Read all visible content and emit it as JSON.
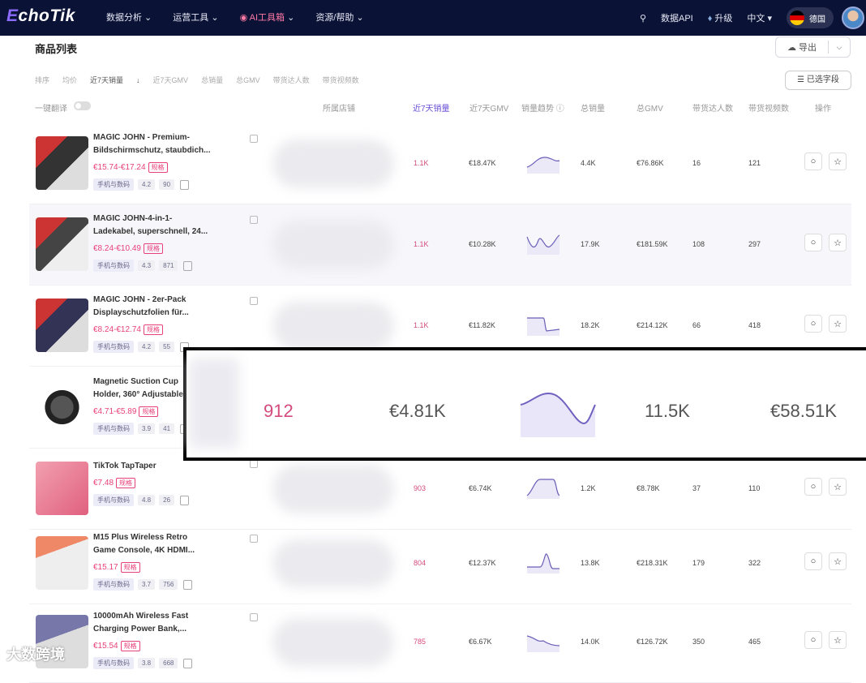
{
  "nav": {
    "logo": "EchoTik",
    "links": [
      "数据分析",
      "运营工具",
      "AI工具箱",
      "资源/帮助"
    ],
    "api": "数据API",
    "upgrade": "升级",
    "lang": "中文",
    "country": "德国"
  },
  "page": {
    "title": "商品列表",
    "export": "导出",
    "fields": "已选字段",
    "translate": "一键翻译"
  },
  "sort": {
    "label": "排序",
    "options": [
      "均价",
      "近7天销量",
      "近7天GMV",
      "总销量",
      "总GMV",
      "带货达人数",
      "带货视频数"
    ]
  },
  "columns": [
    "所属店铺",
    "近7天销量",
    "近7天GMV",
    "销量趋势",
    "总销量",
    "总GMV",
    "带货达人数",
    "带货视频数",
    "操作"
  ],
  "rows": [
    {
      "name1": "MAGIC JOHN - Premium-",
      "name2": "Bildschirmschutz, staubdich...",
      "price": "€15.74-€17.24",
      "spec": "规格",
      "cat": "手机与数码",
      "rating": "4.2",
      "reviews": "90",
      "sales7": "1.1K",
      "gmv7": "€18.47K",
      "total": "4.4K",
      "gmv": "€76.86K",
      "creators": "16",
      "videos": "121"
    },
    {
      "name1": "MAGIC JOHN-4-in-1-",
      "name2": "Ladekabel, superschnell, 24...",
      "price": "€8.24-€10.49",
      "spec": "规格",
      "cat": "手机与数码",
      "rating": "4.3",
      "reviews": "871",
      "sales7": "1.1K",
      "gmv7": "€10.28K",
      "total": "17.9K",
      "gmv": "€181.59K",
      "creators": "108",
      "videos": "297"
    },
    {
      "name1": "MAGIC JOHN - 2er-Pack",
      "name2": "Displayschutzfolien für...",
      "price": "€8.24-€12.74",
      "spec": "规格",
      "cat": "手机与数码",
      "rating": "4.2",
      "reviews": "55",
      "sales7": "1.1K",
      "gmv7": "€11.82K",
      "total": "18.2K",
      "gmv": "€214.12K",
      "creators": "66",
      "videos": "418"
    },
    {
      "name1": "Magnetic Suction Cup",
      "name2": "Holder, 360° Adjustable",
      "price": "€4.71-€5.89",
      "spec": "规格",
      "cat": "手机与数码",
      "rating": "3.9",
      "reviews": "41",
      "sales7": "",
      "gmv7": "",
      "total": "",
      "gmv": "",
      "creators": "",
      "videos": ""
    },
    {
      "name1": "TikTok TapTaper",
      "name2": "",
      "price": "€7.48",
      "spec": "规格",
      "cat": "手机与数码",
      "rating": "4.8",
      "reviews": "26",
      "sales7": "903",
      "gmv7": "€6.74K",
      "total": "1.2K",
      "gmv": "€8.78K",
      "creators": "37",
      "videos": "110"
    },
    {
      "name1": "M15 Plus Wireless Retro",
      "name2": "Game Console, 4K HDMI...",
      "price": "€15.17",
      "spec": "规格",
      "cat": "手机与数码",
      "rating": "3.7",
      "reviews": "756",
      "sales7": "804",
      "gmv7": "€12.37K",
      "total": "13.8K",
      "gmv": "€218.31K",
      "creators": "179",
      "videos": "322"
    },
    {
      "name1": "10000mAh Wireless Fast",
      "name2": "Charging Power Bank,...",
      "price": "€15.54",
      "spec": "规格",
      "cat": "手机与数码",
      "rating": "3.8",
      "reviews": "668",
      "sales7": "785",
      "gmv7": "€6.67K",
      "total": "14.0K",
      "gmv": "€126.72K",
      "creators": "350",
      "videos": "465"
    }
  ],
  "zoom": {
    "sales7": "912",
    "gmv7": "€4.81K",
    "total": "11.5K",
    "gmv": "€58.51K"
  },
  "watermark": "大数跨境"
}
